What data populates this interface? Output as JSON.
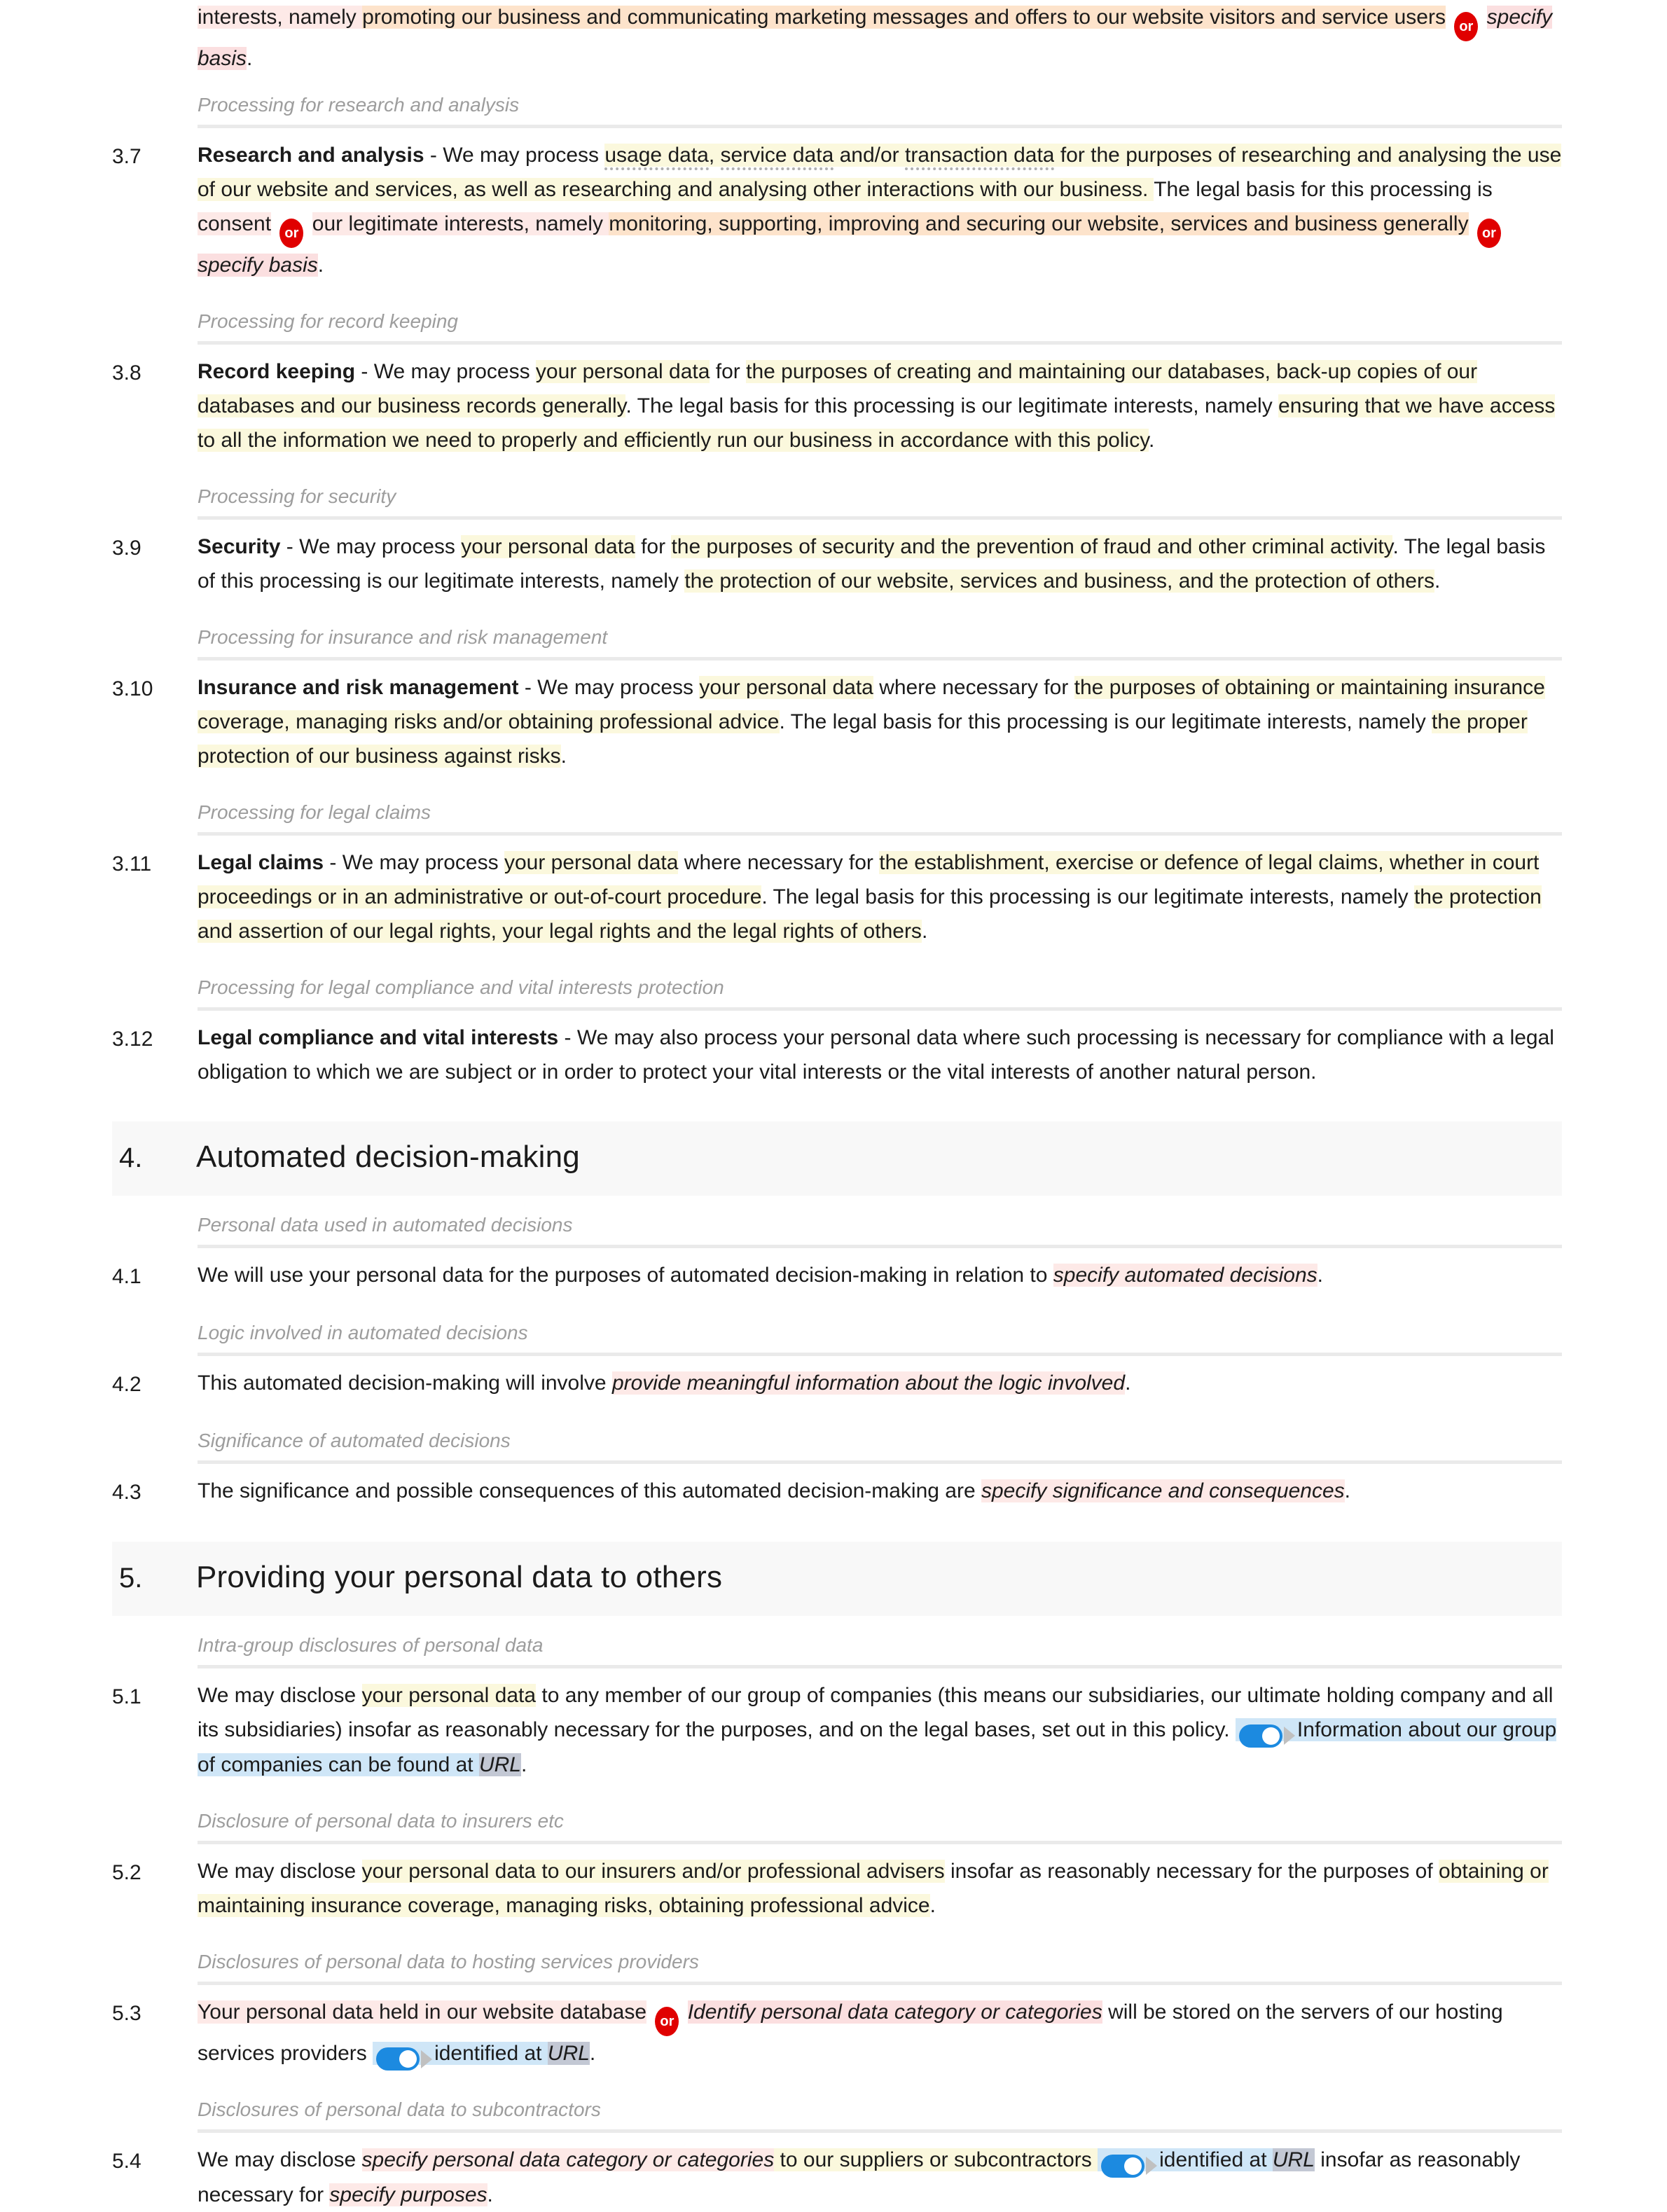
{
  "document": {
    "type": "privacy-policy-template",
    "colors": {
      "highlight_yellow": "#fbf8dd",
      "highlight_orange": "#fde3cb",
      "highlight_pink": "#fbdfe0",
      "highlight_pink_light": "#fde9e7",
      "highlight_blue": "#cfe6f7",
      "url_token": "#c3c8d4",
      "or_badge": "#e00000",
      "toggle_on": "#1c8ae0",
      "section_band": "#f8f8f8",
      "subhead_text": "#9d9d9d",
      "rule": "#eaeaea"
    }
  },
  "or_badge_label": "or",
  "continued": {
    "line1_a": "interests, namely ",
    "line1_b": "promoting our business and communicating marketing messages and offers to our website visitors and service users",
    "line1_c": "specify basis",
    "line1_d": "."
  },
  "clauses": [
    {
      "subhead": "Processing for research and analysis",
      "number": "3.7",
      "lead": "Research and analysis",
      "dash": " - ",
      "t1": "We may process ",
      "terms": [
        "usage data",
        "service data",
        "transaction data"
      ],
      "sep1": ", ",
      "sep2": " and/or ",
      "t2": " for the purposes of researching and analysing the use of our website and services, as well as researching and analysing other interactions with our business. ",
      "t3": "The legal basis for this processing is ",
      "t4": "consent",
      "t5": "our legitimate interests, namely ",
      "t6": "monitoring, supporting, improving and securing our website, services and business generally",
      "t7": "specify basis",
      "t8": "."
    },
    {
      "subhead": "Processing for record keeping",
      "number": "3.8",
      "lead": "Record keeping",
      "dash": " - ",
      "t1": "We may process ",
      "t2": "your personal data",
      "t3": " for ",
      "t4": "the purposes of creating and maintaining our databases, back-up copies of our databases and our business records generally",
      "t5": ". The legal basis for this processing is our legitimate interests, namely ",
      "t6": "ensuring that we have access to all the information we need to properly and efficiently run our business in accordance with this policy",
      "t7": "."
    },
    {
      "subhead": "Processing for security",
      "number": "3.9",
      "lead": "Security",
      "dash": " - ",
      "t1": "We may process ",
      "t2": "your personal data",
      "t3": " for ",
      "t4": "the purposes of security and the prevention of fraud and other criminal activity",
      "t5": ". The legal basis of this processing is our legitimate interests, namely ",
      "t6": "the protection of our website, services and business, and the protection of others",
      "t7": "."
    },
    {
      "subhead": "Processing for insurance and risk management",
      "number": "3.10",
      "lead": "Insurance and risk management",
      "dash": " - ",
      "t1": "We may process ",
      "t2": "your personal data",
      "t3": " where necessary for ",
      "t4": "the purposes of obtaining or maintaining insurance coverage, managing risks and/or obtaining professional advice",
      "t5": ". The legal basis for this processing is our legitimate interests, namely ",
      "t6": "the proper protection of our business against risks",
      "t7": "."
    },
    {
      "subhead": "Processing for legal claims",
      "number": "3.11",
      "lead": "Legal claims",
      "dash": " - ",
      "t1": "We may process ",
      "t2": "your personal data",
      "t3": " where necessary for ",
      "t4": "the establishment, exercise or defence of legal claims, whether in court proceedings or in an administrative or out-of-court procedure",
      "t5": ". The legal basis for this processing is our legitimate interests, namely ",
      "t6": "the protection and assertion of our legal rights, your legal rights and the legal rights of others",
      "t7": "."
    },
    {
      "subhead": "Processing for legal compliance and vital interests protection",
      "number": "3.12",
      "lead": "Legal compliance and vital interests",
      "dash": " - ",
      "t1": "We may also process your personal data where such processing is necessary for compliance with a legal obligation to which we are subject or in order to protect your vital interests or the vital interests of another natural person."
    }
  ],
  "section4": {
    "number": "4.",
    "title": "Automated decision-making",
    "items": [
      {
        "subhead": "Personal data used in automated decisions",
        "number": "4.1",
        "t1": "We will use your personal data for the purposes of automated decision-making in relation to ",
        "ph": "specify automated decisions",
        "t2": "."
      },
      {
        "subhead": "Logic involved in automated decisions",
        "number": "4.2",
        "t1": "This automated decision-making will involve ",
        "ph": "provide meaningful information about the logic involved",
        "t2": "."
      },
      {
        "subhead": "Significance of automated decisions",
        "number": "4.3",
        "t1": "The significance and possible consequences of this automated decision-making are ",
        "ph": "specify significance and consequences",
        "t2": "."
      }
    ]
  },
  "section5": {
    "number": "5.",
    "title": "Providing your personal data to others",
    "items": [
      {
        "subhead": "Intra-group disclosures of personal data",
        "number": "5.1",
        "t1": "We may disclose ",
        "t2": "your personal data",
        "t3": " to any member of our group of companies (this means our subsidiaries, our ultimate holding company and all its subsidiaries) insofar as reasonably necessary for the purposes, and on the legal bases, set out in this policy. ",
        "note": "Information about our group of companies can be found at ",
        "url": "URL",
        "t4": "."
      },
      {
        "subhead": "Disclosure of personal data to insurers etc",
        "number": "5.2",
        "t1": "We may disclose ",
        "t2": "your personal data to our insurers and/or professional advisers",
        "t3": " insofar as reasonably necessary for the purposes of ",
        "t4": "obtaining or maintaining insurance coverage, managing risks, obtaining professional advice",
        "t5": "."
      },
      {
        "subhead": "Disclosures of personal data to hosting services providers",
        "number": "5.3",
        "t1": "Your personal data held in our website database",
        "ph": "Identify personal data category or categories",
        "t2": " will be stored on the servers of our hosting services providers ",
        "note": "identified at ",
        "url": "URL",
        "t3": "."
      },
      {
        "subhead": "Disclosures of personal data to subcontractors",
        "number": "5.4",
        "t1": "We may disclose ",
        "ph1": "specify personal data category or categories",
        "t2": " to our suppliers or subcontractors ",
        "note": "identified at ",
        "url": "URL",
        "t3": " insofar as reasonably necessary for ",
        "ph2": "specify purposes",
        "t4": "."
      }
    ]
  }
}
